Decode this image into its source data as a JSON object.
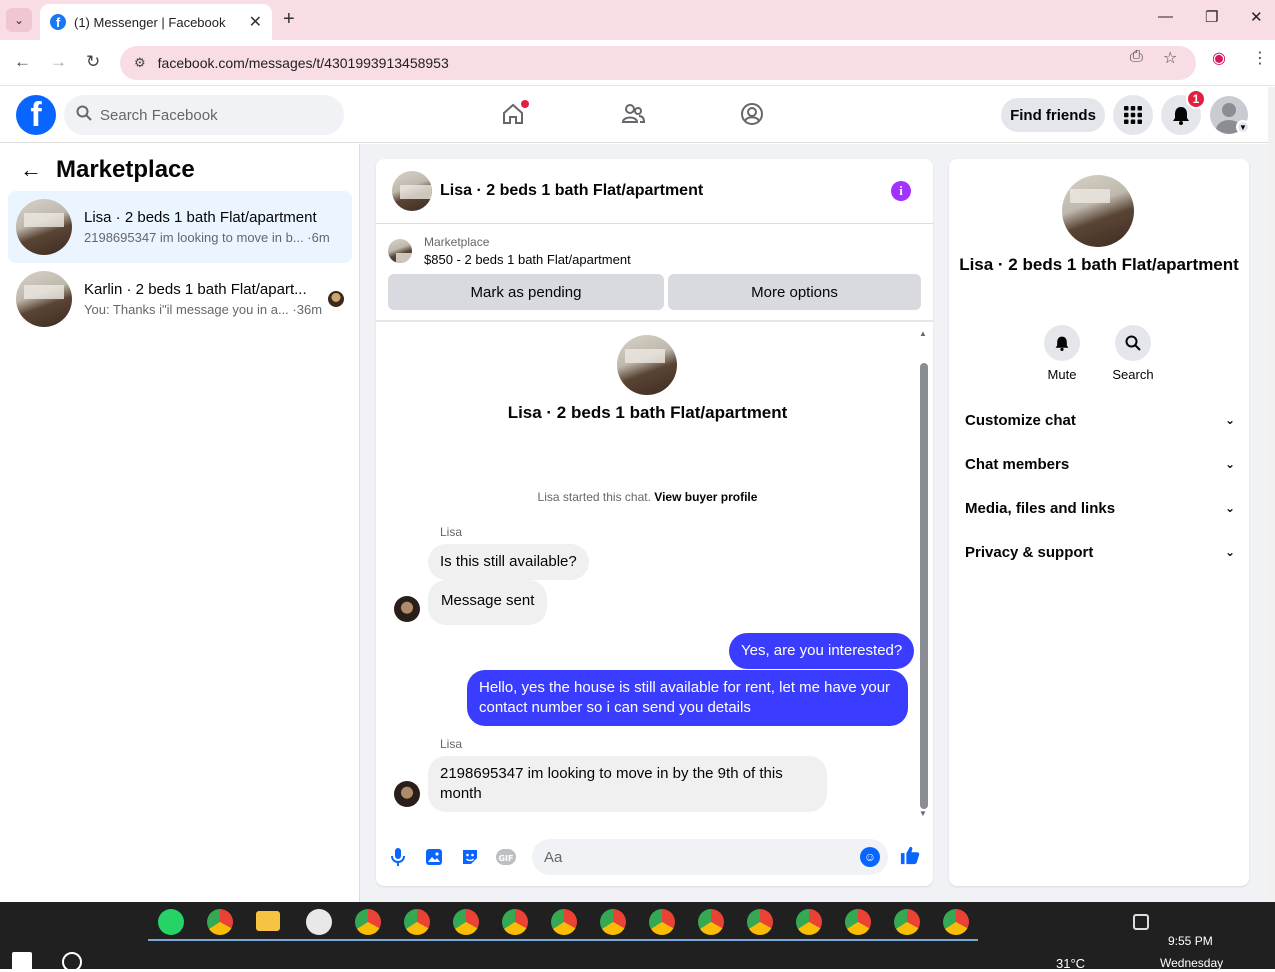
{
  "browser": {
    "tab_title": "(1) Messenger | Facebook",
    "url": "facebook.com/messages/t/4301993913458953"
  },
  "fb": {
    "search_placeholder": "Search Facebook",
    "find_friends": "Find friends",
    "notification_count": "1"
  },
  "sidebar": {
    "title": "Marketplace",
    "conversations": [
      {
        "name": "Lisa · 2 beds 1 bath Flat/apartment",
        "preview": "2198695347 im looking to move in b... ·6m"
      },
      {
        "name": "Karlin · 2 beds 1 bath Flat/apart...",
        "preview": "You: Thanks i\"il message you in a... ·36m"
      }
    ]
  },
  "chat": {
    "header_name": "Lisa · 2 beds 1 bath Flat/apartment",
    "marketplace_label": "Marketplace",
    "listing": "$850 - 2 beds 1 bath Flat/apartment",
    "mark_pending": "Mark as pending",
    "more_options": "More options",
    "intro_name": "Lisa · 2 beds 1 bath Flat/apartment",
    "started_text": "Lisa started this chat.",
    "view_profile": "View buyer profile",
    "sender1": "Lisa",
    "msg1": "Is this still available?",
    "msg2": "Message sent",
    "out1": "Yes, are you interested?",
    "out2": "Hello, yes the house is still available for rent, let me have your contact number so i can send you details",
    "sender2": "Lisa",
    "msg3": "2198695347 im looking to move in by the 9th of this month",
    "composer_placeholder": "Aa"
  },
  "details": {
    "name": "Lisa · 2 beds 1 bath Flat/apartment",
    "mute": "Mute",
    "search": "Search",
    "rows": [
      "Customize chat",
      "Chat members",
      "Media, files and links",
      "Privacy & support"
    ]
  },
  "taskbar": {
    "time": "9:55 PM",
    "day": "Wednesday",
    "temp": "31°C"
  },
  "colors": {
    "accent": "#0866ff",
    "outgoing_bubble": "#3a3dff",
    "info": "#a033ff",
    "notification": "#e41e3f"
  }
}
